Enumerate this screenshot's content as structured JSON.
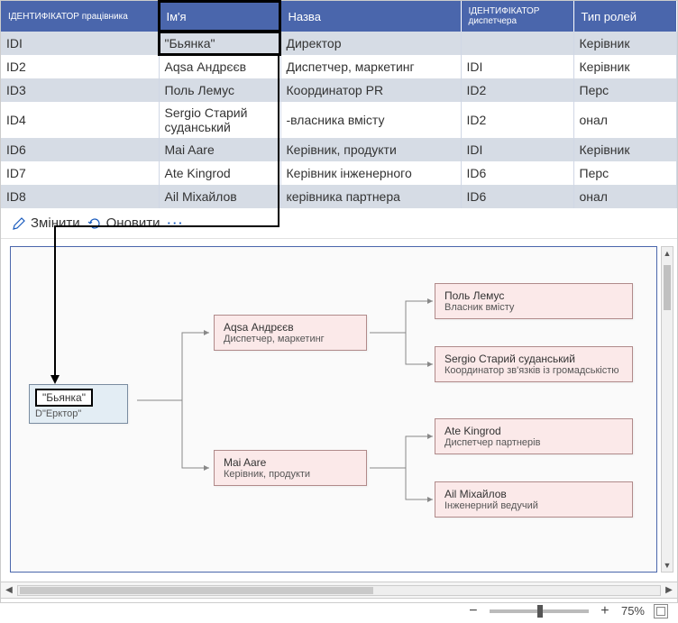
{
  "table": {
    "headers": [
      "ІДЕНТИФІКАТОР працівника",
      "Ім'я",
      "Назва",
      "ІДЕНТИФІКАТОР диспетчера",
      "Тип ролей"
    ],
    "rows": [
      {
        "id": "IDI",
        "name": "\"Бьянка\"",
        "title": "Директор",
        "mgr": "",
        "role": "Керівник"
      },
      {
        "id": "ID2",
        "name": "Aqsa Андрєєв",
        "title": "Диспетчер, маркетинг",
        "mgr": "IDI",
        "role": "Керівник"
      },
      {
        "id": "ID3",
        "name": "Поль Лемус",
        "title": "Координатор PR",
        "mgr": "ID2",
        "role": "Перс"
      },
      {
        "id": "ID4",
        "name": "Sergio Старий суданський",
        "title": "-власника вмісту",
        "mgr": "ID2",
        "role": "онал"
      },
      {
        "id": "ID6",
        "name": "Mai Aare",
        "title": "Керівник, продукти",
        "mgr": "IDI",
        "role": "Керівник"
      },
      {
        "id": "ID7",
        "name": "Ate Kingrod",
        "title": "Керівник інженерного",
        "mgr": "ID6",
        "role": "Перс"
      },
      {
        "id": "ID8",
        "name": "Ail Міхайлов",
        "title": "керівника партнера",
        "mgr": "ID6",
        "role": "онал"
      }
    ]
  },
  "toolbar": {
    "edit": "Змінити",
    "refresh": "Оновити",
    "more": "···"
  },
  "org": {
    "root": {
      "name": "\"Бьянка\"",
      "role": "D\"Ерктор\""
    },
    "l1a": {
      "name": "Aqsa Андрєєв",
      "role": "Диспетчер, маркетинг"
    },
    "l1b": {
      "name": "Mai Aare",
      "role": "Керівник, продукти"
    },
    "l2a": {
      "name": "Поль Лемус",
      "role": "Власник вмісту"
    },
    "l2b": {
      "name": "Sergio Старий суданський",
      "role": "Координатор зв'язків із громадськістю"
    },
    "l2c": {
      "name": "Ate Kingrod",
      "role": "Диспетчер партнерів"
    },
    "l2d": {
      "name": "Ail Міхайлов",
      "role": "Інженерний ведучий"
    }
  },
  "status": {
    "zoom": "75%"
  }
}
